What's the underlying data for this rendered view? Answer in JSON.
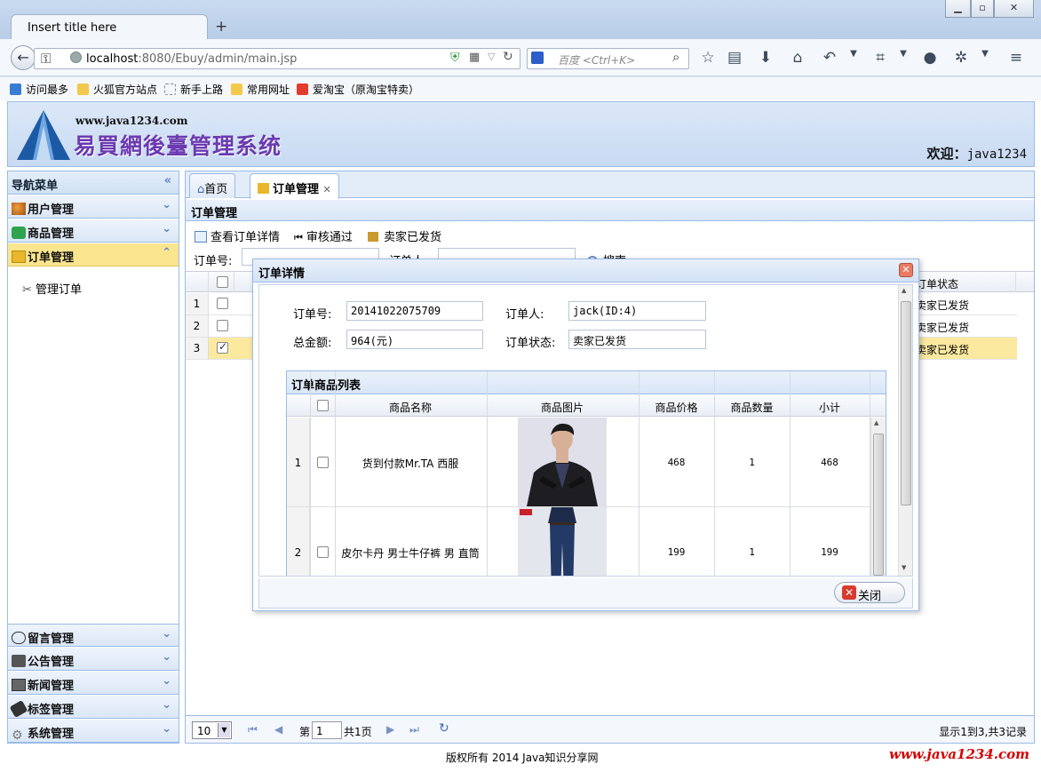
{
  "browser": {
    "tab_title": "Insert title here",
    "url_host": "localhost",
    "url_rest": ":8080/Ebuy/admin/main.jsp",
    "search_placeholder": "百度 <Ctrl+K>",
    "bookmarks": [
      "访问最多",
      "火狐官方站点",
      "新手上路",
      "常用网址",
      "爱淘宝（原淘宝特卖）"
    ]
  },
  "header": {
    "site_url": "www.java1234.com",
    "title": "易買網後臺管理系统",
    "welcome_label": "欢迎：",
    "username": "java1234"
  },
  "nav": {
    "title": "导航菜单",
    "items": [
      {
        "label": "用户管理",
        "icon": "users-icon"
      },
      {
        "label": "商品管理",
        "icon": "list-icon"
      },
      {
        "label": "订单管理",
        "icon": "order-icon",
        "selected": true
      },
      {
        "label": "留言管理",
        "icon": "comment-icon"
      },
      {
        "label": "公告管理",
        "icon": "notice-icon"
      },
      {
        "label": "新闻管理",
        "icon": "news-icon"
      },
      {
        "label": "标签管理",
        "icon": "tag-icon"
      },
      {
        "label": "系统管理",
        "icon": "gear-icon"
      }
    ],
    "sub_item": "管理订单"
  },
  "main": {
    "tabs": [
      {
        "label": "首页"
      },
      {
        "label": "订单管理",
        "closable": true
      }
    ],
    "panel_title": "订单管理",
    "toolbar": [
      "查看订单详情",
      "审核通过",
      "卖家已发货"
    ],
    "search": {
      "order_no_label": "订单号:",
      "orderer_label": "订单人:",
      "search_btn": "搜索"
    },
    "grid": {
      "status_header": "订单状态",
      "rows": [
        {
          "num": "1",
          "checked": false,
          "status": "卖家已发货"
        },
        {
          "num": "2",
          "checked": false,
          "status": "卖家已发货"
        },
        {
          "num": "3",
          "checked": true,
          "status": "卖家已发货"
        }
      ]
    },
    "pager": {
      "page_size": "10",
      "page_label_pre": "第",
      "page_value": "1",
      "page_label_post": "共1页",
      "summary": "显示1到3,共3记录"
    }
  },
  "dialog": {
    "title": "订单详情",
    "fields": {
      "order_no_label": "订单号:",
      "order_no": "20141022075709",
      "orderer_label": "订单人:",
      "orderer": "jack(ID:4)",
      "total_label": "总金额:",
      "total": "964(元)",
      "status_label": "订单状态:",
      "status": "卖家已发货"
    },
    "product_list": {
      "title": "订单商品列表",
      "headers": [
        "商品名称",
        "商品图片",
        "商品价格",
        "商品数量",
        "小计"
      ],
      "rows": [
        {
          "num": "1",
          "name": "货到付款Mr.TA 西服",
          "price": "468",
          "qty": "1",
          "subtotal": "468"
        },
        {
          "num": "2",
          "name": "皮尔卡丹 男士牛仔裤 男 直筒",
          "price": "199",
          "qty": "1",
          "subtotal": "199"
        }
      ]
    },
    "close_btn": "关闭"
  },
  "footer": {
    "copyright": "版权所有 2014 Java知识分享网",
    "site": "www.java1234.com"
  }
}
